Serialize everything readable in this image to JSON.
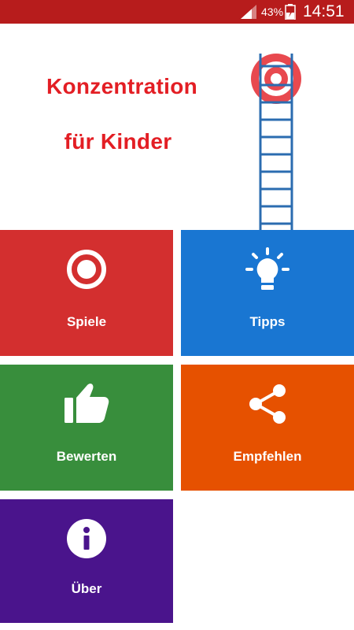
{
  "status_bar": {
    "battery_percent": "43%",
    "time": "14:51"
  },
  "header": {
    "title_line1": "Konzentration",
    "title_line2": "für Kinder",
    "logo": "target-ladder-logo"
  },
  "tiles": [
    {
      "id": "spiele",
      "label": "Spiele",
      "icon": "target-icon",
      "color": "#d32f2f"
    },
    {
      "id": "tipps",
      "label": "Tipps",
      "icon": "lightbulb-icon",
      "color": "#1976d2"
    },
    {
      "id": "bewerten",
      "label": "Bewerten",
      "icon": "thumbs-up-icon",
      "color": "#388e3c"
    },
    {
      "id": "empfehlen",
      "label": "Empfehlen",
      "icon": "share-icon",
      "color": "#e65100"
    },
    {
      "id": "ueber",
      "label": "Über",
      "icon": "info-icon",
      "color": "#4a148c"
    }
  ],
  "colors": {
    "status_bar": "#b71c1c",
    "title": "#e31e24",
    "ladder": "#2b6cb0",
    "target": "#e8494f"
  }
}
